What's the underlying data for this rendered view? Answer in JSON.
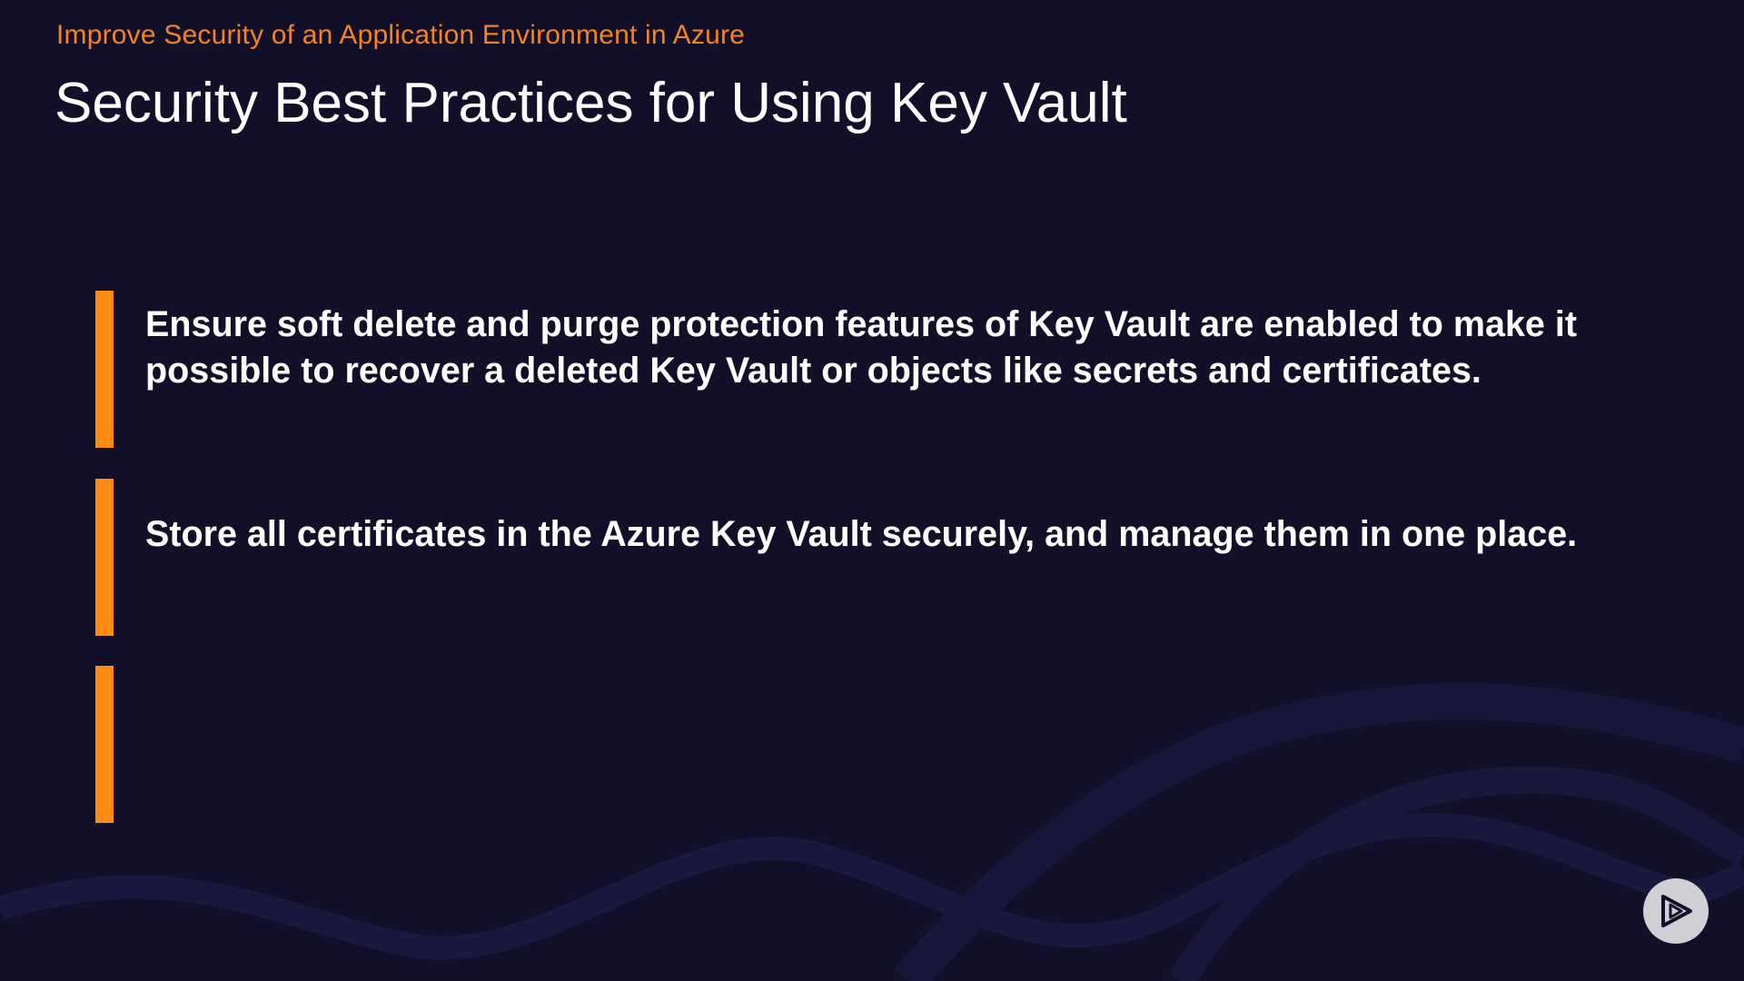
{
  "course_title": "Improve Security of an Application Environment in Azure",
  "slide_title": "Security Best Practices for Using Key Vault",
  "bullets": [
    {
      "text": "Ensure soft delete and purge protection features of Key Vault are enabled to make it possible to recover a deleted Key Vault or objects like secrets and certificates."
    },
    {
      "text": "Store all certificates in the Azure Key Vault securely, and manage them in one place."
    },
    {
      "text": ""
    }
  ],
  "colors": {
    "background": "#121028",
    "accent": "#ff8c12",
    "title": "#ffffff"
  },
  "icons": {
    "player": "play-logo-icon"
  }
}
